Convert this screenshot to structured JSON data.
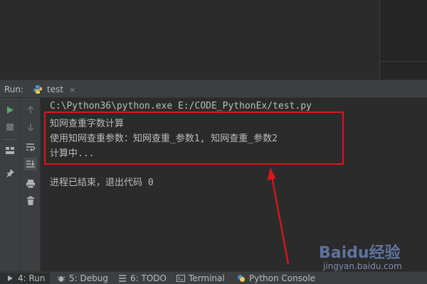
{
  "run_header": {
    "label": "Run:",
    "tab_name": "test",
    "tab_close": "×"
  },
  "console": {
    "lines": [
      "C:\\Python36\\python.exe E:/CODE_PythonEx/test.py",
      "知网查重字数计算",
      "使用知网查重参数：知网查重_参数1, 知网查重_参数2",
      "计算中...",
      "进程已结束，退出代码 0"
    ]
  },
  "toolbar_icons": [
    "play-icon",
    "stop-icon",
    "arrow-up-icon",
    "arrow-down-icon",
    "layout-icon",
    "soft-wrap-icon",
    "pin-icon",
    "scroll-to-end-icon",
    "print-icon",
    "trash-icon"
  ],
  "status_bar": {
    "tabs": [
      {
        "label": "4: Run"
      },
      {
        "label": "5: Debug"
      },
      {
        "label": "6: TODO"
      },
      {
        "label": "Terminal"
      },
      {
        "label": "Python Console"
      }
    ]
  },
  "watermark": {
    "brand": "Baidu经验",
    "url": "jingyan.baidu.com"
  },
  "colors": {
    "highlight": "#e0141e",
    "run_green": "#59a869",
    "background": "#2b2b2b",
    "panel": "#3c3f41"
  }
}
